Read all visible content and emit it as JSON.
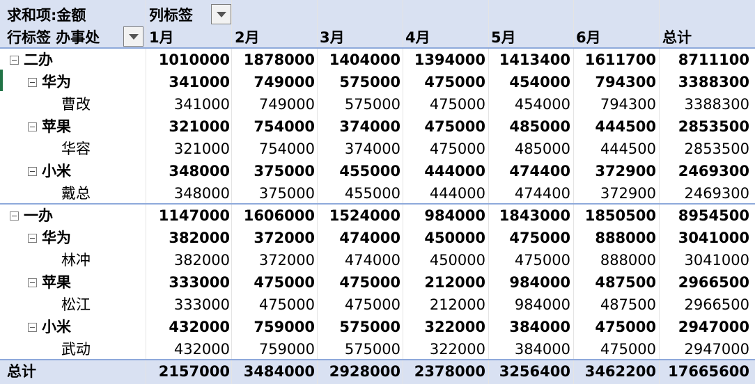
{
  "pivot": {
    "value_field_label": "求和项:金额",
    "column_labels_caption": "列标签",
    "row_labels_caption": "行标签 办事处",
    "months": [
      "1月",
      "2月",
      "3月",
      "4月",
      "5月",
      "6月"
    ],
    "total_header": "总计",
    "rows": [
      {
        "level": 0,
        "label": "二办",
        "values": [
          "1010000",
          "1878000",
          "1404000",
          "1394000",
          "1413400",
          "1611700"
        ],
        "total": "8711100"
      },
      {
        "level": 1,
        "label": "华为",
        "values": [
          "341000",
          "749000",
          "575000",
          "475000",
          "454000",
          "794300"
        ],
        "total": "3388300"
      },
      {
        "level": 2,
        "label": "曹改",
        "values": [
          "341000",
          "749000",
          "575000",
          "475000",
          "454000",
          "794300"
        ],
        "total": "3388300"
      },
      {
        "level": 1,
        "label": "苹果",
        "values": [
          "321000",
          "754000",
          "374000",
          "475000",
          "485000",
          "444500"
        ],
        "total": "2853500"
      },
      {
        "level": 2,
        "label": "华容",
        "values": [
          "321000",
          "754000",
          "374000",
          "475000",
          "485000",
          "444500"
        ],
        "total": "2853500"
      },
      {
        "level": 1,
        "label": "小米",
        "values": [
          "348000",
          "375000",
          "455000",
          "444000",
          "474400",
          "372900"
        ],
        "total": "2469300"
      },
      {
        "level": 2,
        "label": "戴总",
        "values": [
          "348000",
          "375000",
          "455000",
          "444000",
          "474400",
          "372900"
        ],
        "total": "2469300"
      },
      {
        "level": 0,
        "label": "一办",
        "values": [
          "1147000",
          "1606000",
          "1524000",
          "984000",
          "1843000",
          "1850500"
        ],
        "total": "8954500"
      },
      {
        "level": 1,
        "label": "华为",
        "values": [
          "382000",
          "372000",
          "474000",
          "450000",
          "475000",
          "888000"
        ],
        "total": "3041000"
      },
      {
        "level": 2,
        "label": "林冲",
        "values": [
          "382000",
          "372000",
          "474000",
          "450000",
          "475000",
          "888000"
        ],
        "total": "3041000"
      },
      {
        "level": 1,
        "label": "苹果",
        "values": [
          "333000",
          "475000",
          "475000",
          "212000",
          "984000",
          "487500"
        ],
        "total": "2966500"
      },
      {
        "level": 2,
        "label": "松江",
        "values": [
          "333000",
          "475000",
          "475000",
          "212000",
          "984000",
          "487500"
        ],
        "total": "2966500"
      },
      {
        "level": 1,
        "label": "小米",
        "values": [
          "432000",
          "759000",
          "575000",
          "322000",
          "384000",
          "475000"
        ],
        "total": "2947000"
      },
      {
        "level": 2,
        "label": "武动",
        "values": [
          "432000",
          "759000",
          "575000",
          "322000",
          "384000",
          "475000"
        ],
        "total": "2947000"
      }
    ],
    "grand_total": {
      "label": "总计",
      "values": [
        "2157000",
        "3484000",
        "2928000",
        "2378000",
        "3256400",
        "3462200"
      ],
      "total": "17665600"
    }
  },
  "icons": {
    "collapse_toggle": "minus-box-icon",
    "filter_dropdown": "dropdown-arrow-icon"
  },
  "colors": {
    "header_fill": "#d9e1f2",
    "group_line": "#8ea9db",
    "gridline": "#e4e4e4"
  }
}
